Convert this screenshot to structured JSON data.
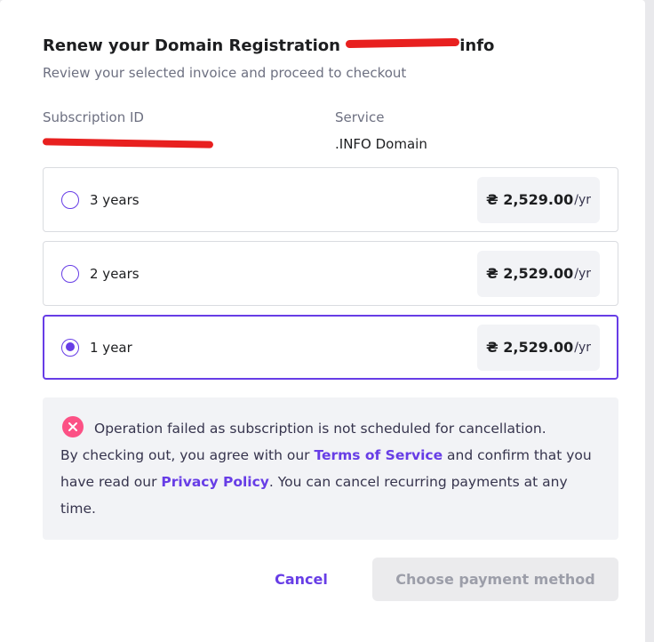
{
  "dialog": {
    "title_prefix": "Renew your Domain Registration",
    "title_suffix": "info",
    "subtitle": "Review your selected invoice and proceed to checkout"
  },
  "details": {
    "subscription_id_label": "Subscription ID",
    "service_label": "Service",
    "service_value": ".INFO Domain"
  },
  "options": [
    {
      "label": "3 years",
      "price": "₴ 2,529.00",
      "per": "/yr",
      "selected": false
    },
    {
      "label": "2 years",
      "price": "₴ 2,529.00",
      "per": "/yr",
      "selected": false
    },
    {
      "label": "1 year",
      "price": "₴ 2,529.00",
      "per": "/yr",
      "selected": true
    }
  ],
  "alert": {
    "error": "Operation failed as subscription is not scheduled for cancellation.",
    "text1": "By checking out, you agree with our ",
    "terms_link": "Terms of Service",
    "text2": " and confirm that you have read our ",
    "privacy_link": "Privacy Policy",
    "text3": ". You can cancel recurring payments at any time."
  },
  "actions": {
    "cancel": "Cancel",
    "choose_payment": "Choose payment method"
  },
  "colors": {
    "accent": "#673de6",
    "error": "#fc5185",
    "redaction": "#e8201f"
  }
}
